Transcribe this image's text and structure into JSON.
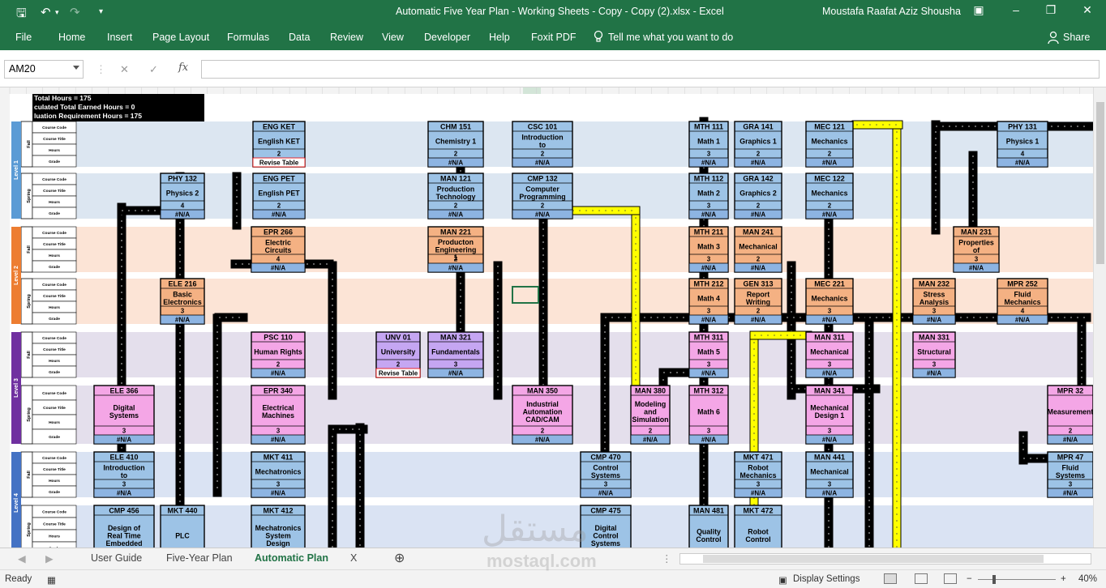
{
  "window": {
    "title": "Automatic Five Year Plan - Working Sheets - Copy - Copy (2).xlsx  -  Excel",
    "user": "Moustafa Raafat Aziz Shousha"
  },
  "ribbon": {
    "tabs": [
      "File",
      "Home",
      "Insert",
      "Page Layout",
      "Formulas",
      "Data",
      "Review",
      "View",
      "Developer",
      "Help",
      "Foxit PDF"
    ],
    "tell_me": "Tell me what you want to do",
    "share": "Share"
  },
  "formula_bar": {
    "name_box": "AM20",
    "fx": "fx",
    "value": ""
  },
  "summary": [
    "Total Hours =  175",
    "culated Total Earned Hours =  0",
    "luation Requirement Hours =  175"
  ],
  "row_labels": [
    "Course Code",
    "Course Title",
    "Hours",
    "Grade"
  ],
  "levels": [
    "Level 1",
    "Level 2",
    "Level 3",
    "Level 4"
  ],
  "terms": [
    "Fall",
    "Spring"
  ],
  "courses": [
    {
      "code": "ENG KET",
      "title": "English KET",
      "hours": "2",
      "grade": "Revise Table"
    },
    {
      "code": "CHM 151",
      "title": "Chemistry 1",
      "hours": "2",
      "grade": "#N/A"
    },
    {
      "code": "CSC 101",
      "title": "Introduction to",
      "hours": "2",
      "grade": "#N/A"
    },
    {
      "code": "MTH 111",
      "title": "Math 1",
      "hours": "3",
      "grade": "#N/A"
    },
    {
      "code": "GRA 141",
      "title": "Graphics 1",
      "hours": "2",
      "grade": "#N/A"
    },
    {
      "code": "MEC 121",
      "title": "Mechanics",
      "hours": "2",
      "grade": "#N/A"
    },
    {
      "code": "PHY 131",
      "title": "Physics 1",
      "hours": "4",
      "grade": "#N/A"
    },
    {
      "code": "PHY 132",
      "title": "Physics 2",
      "hours": "4",
      "grade": "#N/A"
    },
    {
      "code": "ENG PET",
      "title": "English PET",
      "hours": "2",
      "grade": "#N/A"
    },
    {
      "code": "MAN 121",
      "title": "Production Technology",
      "hours": "2",
      "grade": "#N/A"
    },
    {
      "code": "CMP 132",
      "title": "Computer Programming",
      "hours": "2",
      "grade": "#N/A"
    },
    {
      "code": "MTH 112",
      "title": "Math 2",
      "hours": "3",
      "grade": "#N/A"
    },
    {
      "code": "GRA 142",
      "title": "Graphics 2",
      "hours": "2",
      "grade": "#N/A"
    },
    {
      "code": "MEC 122",
      "title": "Mechanics",
      "hours": "2",
      "grade": "#N/A"
    },
    {
      "code": "EPR 266",
      "title": "Electric Circuits",
      "hours": "4",
      "grade": "#N/A"
    },
    {
      "code": "MAN 221",
      "title": "Producton Engineering 1",
      "hours": "2",
      "grade": "#N/A"
    },
    {
      "code": "MTH 211",
      "title": "Math 3",
      "hours": "3",
      "grade": "#N/A"
    },
    {
      "code": "MAN 241",
      "title": "Mechanical",
      "hours": "2",
      "grade": "#N/A"
    },
    {
      "code": "MAN 231",
      "title": "Properties of",
      "hours": "3",
      "grade": "#N/A"
    },
    {
      "code": "ELE 216",
      "title": "Basic Electronics",
      "hours": "3",
      "grade": "#N/A"
    },
    {
      "code": "MTH 212",
      "title": "Math 4",
      "hours": "3",
      "grade": "#N/A"
    },
    {
      "code": "GEN 313",
      "title": "Report Writing",
      "hours": "2",
      "grade": "#N/A"
    },
    {
      "code": "MEC 221",
      "title": "Mechanics",
      "hours": "3",
      "grade": "#N/A"
    },
    {
      "code": "MAN 232",
      "title": "Stress Analysis",
      "hours": "3",
      "grade": "#N/A"
    },
    {
      "code": "MPR 252",
      "title": "Fluid Mechanics",
      "hours": "4",
      "grade": "#N/A"
    },
    {
      "code": "PSC 110",
      "title": "Human Rights",
      "hours": "2",
      "grade": "#N/A"
    },
    {
      "code": "UNV 01",
      "title": "University",
      "hours": "2",
      "grade": "Revise Table"
    },
    {
      "code": "MAN 321",
      "title": "Fundamentals",
      "hours": "3",
      "grade": "#N/A"
    },
    {
      "code": "MTH 311",
      "title": "Math 5",
      "hours": "3",
      "grade": "#N/A"
    },
    {
      "code": "MAN 311",
      "title": "Mechanical",
      "hours": "3",
      "grade": "#N/A"
    },
    {
      "code": "MAN 331",
      "title": "Structural",
      "hours": "3",
      "grade": "#N/A"
    },
    {
      "code": "ELE 366",
      "title": "Digital Systems",
      "hours": "3",
      "grade": "#N/A"
    },
    {
      "code": "EPR 340",
      "title": "Electrical Machines",
      "hours": "3",
      "grade": "#N/A"
    },
    {
      "code": "MAN 350",
      "title": "Industrial Automation CAD/CAM",
      "hours": "2",
      "grade": "#N/A"
    },
    {
      "code": "MAN 380",
      "title": "Modeling and Simulation",
      "hours": "2",
      "grade": "#N/A"
    },
    {
      "code": "MTH 312",
      "title": "Math 6",
      "hours": "3",
      "grade": "#N/A"
    },
    {
      "code": "MAN 341",
      "title": "Mechanical Design 1",
      "hours": "3",
      "grade": "#N/A"
    },
    {
      "code": "MPR 32",
      "title": "Measurement",
      "hours": "2",
      "grade": "#N/A"
    },
    {
      "code": "ELE 410",
      "title": "Introduction to",
      "hours": "3",
      "grade": "#N/A"
    },
    {
      "code": "MKT 411",
      "title": "Mechatronics",
      "hours": "3",
      "grade": "#N/A"
    },
    {
      "code": "CMP 470",
      "title": "Control Systems",
      "hours": "3",
      "grade": "#N/A"
    },
    {
      "code": "MKT 471",
      "title": "Robot Mechanics",
      "hours": "3",
      "grade": "#N/A"
    },
    {
      "code": "MAN 441",
      "title": "Mechanical",
      "hours": "3",
      "grade": "#N/A"
    },
    {
      "code": "MPR 47",
      "title": "Fluid Systems",
      "hours": "3",
      "grade": "#N/A"
    },
    {
      "code": "CMP 456",
      "title": "Design of Real Time Embedded",
      "hours": "",
      "grade": ""
    },
    {
      "code": "MKT 440",
      "title": "PLC",
      "hours": "",
      "grade": ""
    },
    {
      "code": "MKT 412",
      "title": "Mechatronics System Design",
      "hours": "",
      "grade": ""
    },
    {
      "code": "CMP 475",
      "title": "Digital Control Systems",
      "hours": "",
      "grade": ""
    },
    {
      "code": "MAN 481",
      "title": "Quality Control",
      "hours": "",
      "grade": ""
    },
    {
      "code": "MKT 472",
      "title": "Robot Control",
      "hours": "",
      "grade": ""
    }
  ],
  "sheet_tabs": [
    "User Guide",
    "Five-Year Plan",
    "Automatic Plan",
    "X"
  ],
  "active_tab": "Automatic Plan",
  "status": {
    "ready": "Ready",
    "display_settings": "Display Settings",
    "zoom": "40%"
  },
  "watermark": {
    "arabic": "مستقل",
    "latin": "mostaql.com"
  },
  "colors": {
    "excel_green": "#217346",
    "level1_band": "#dce6f1",
    "level2_band": "#fce4d6",
    "level3_band": "#e4dfec",
    "level4_band": "#dae3f3",
    "box_blue": "#9dc3e6",
    "box_orange": "#f4b183",
    "box_pink": "#f4a6e6",
    "box_purple": "#c5a6f2",
    "grade_bar": "#8db4e2",
    "arrow_black": "#000000",
    "arrow_yellow": "#ffff00",
    "level1_tag": "#5b9bd5",
    "level2_tag": "#ed7d31",
    "level3_tag": "#7030a0",
    "level4_tag": "#4472c4"
  }
}
